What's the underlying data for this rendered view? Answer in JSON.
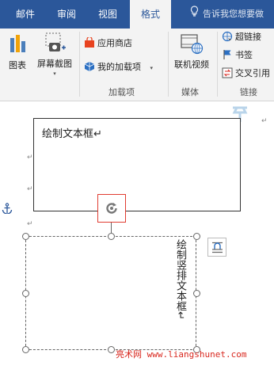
{
  "tabs": [
    "邮件",
    "审阅",
    "视图",
    "格式"
  ],
  "tell_me": "告诉我您想要做",
  "ribbon": {
    "illustrations": {
      "chart_label": "图表",
      "screenshot_label": "屏幕截图"
    },
    "addins": {
      "store_label": "应用商店",
      "my_addins_label": "我的加载项",
      "group_label": "加载项"
    },
    "media": {
      "online_video_label": "联机视频",
      "group_label": "媒体"
    },
    "links": {
      "hyperlink_label": "超链接",
      "bookmark_label": "书签",
      "cross_ref_label": "交叉引用",
      "group_label": "链接"
    }
  },
  "document": {
    "textbox1_text": "绘制文本框↵",
    "textbox2_text": "绘制竖排文本框↵",
    "pilcrow": "↵"
  },
  "watermark": "亮术网 www.liangshunet.com",
  "colors": {
    "tab_bar": "#2b579a",
    "rotate_highlight": "#e03c31",
    "watermark": "#d8261d"
  }
}
